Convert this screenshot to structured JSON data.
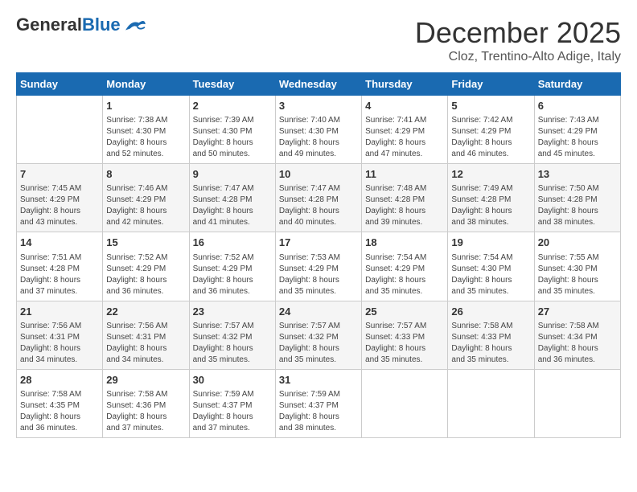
{
  "header": {
    "logo_general": "General",
    "logo_blue": "Blue",
    "month_title": "December 2025",
    "location": "Cloz, Trentino-Alto Adige, Italy"
  },
  "weekdays": [
    "Sunday",
    "Monday",
    "Tuesday",
    "Wednesday",
    "Thursday",
    "Friday",
    "Saturday"
  ],
  "weeks": [
    [
      {
        "day": "",
        "info": ""
      },
      {
        "day": "1",
        "info": "Sunrise: 7:38 AM\nSunset: 4:30 PM\nDaylight: 8 hours\nand 52 minutes."
      },
      {
        "day": "2",
        "info": "Sunrise: 7:39 AM\nSunset: 4:30 PM\nDaylight: 8 hours\nand 50 minutes."
      },
      {
        "day": "3",
        "info": "Sunrise: 7:40 AM\nSunset: 4:30 PM\nDaylight: 8 hours\nand 49 minutes."
      },
      {
        "day": "4",
        "info": "Sunrise: 7:41 AM\nSunset: 4:29 PM\nDaylight: 8 hours\nand 47 minutes."
      },
      {
        "day": "5",
        "info": "Sunrise: 7:42 AM\nSunset: 4:29 PM\nDaylight: 8 hours\nand 46 minutes."
      },
      {
        "day": "6",
        "info": "Sunrise: 7:43 AM\nSunset: 4:29 PM\nDaylight: 8 hours\nand 45 minutes."
      }
    ],
    [
      {
        "day": "7",
        "info": "Sunrise: 7:45 AM\nSunset: 4:29 PM\nDaylight: 8 hours\nand 43 minutes."
      },
      {
        "day": "8",
        "info": "Sunrise: 7:46 AM\nSunset: 4:29 PM\nDaylight: 8 hours\nand 42 minutes."
      },
      {
        "day": "9",
        "info": "Sunrise: 7:47 AM\nSunset: 4:28 PM\nDaylight: 8 hours\nand 41 minutes."
      },
      {
        "day": "10",
        "info": "Sunrise: 7:47 AM\nSunset: 4:28 PM\nDaylight: 8 hours\nand 40 minutes."
      },
      {
        "day": "11",
        "info": "Sunrise: 7:48 AM\nSunset: 4:28 PM\nDaylight: 8 hours\nand 39 minutes."
      },
      {
        "day": "12",
        "info": "Sunrise: 7:49 AM\nSunset: 4:28 PM\nDaylight: 8 hours\nand 38 minutes."
      },
      {
        "day": "13",
        "info": "Sunrise: 7:50 AM\nSunset: 4:28 PM\nDaylight: 8 hours\nand 38 minutes."
      }
    ],
    [
      {
        "day": "14",
        "info": "Sunrise: 7:51 AM\nSunset: 4:28 PM\nDaylight: 8 hours\nand 37 minutes."
      },
      {
        "day": "15",
        "info": "Sunrise: 7:52 AM\nSunset: 4:29 PM\nDaylight: 8 hours\nand 36 minutes."
      },
      {
        "day": "16",
        "info": "Sunrise: 7:52 AM\nSunset: 4:29 PM\nDaylight: 8 hours\nand 36 minutes."
      },
      {
        "day": "17",
        "info": "Sunrise: 7:53 AM\nSunset: 4:29 PM\nDaylight: 8 hours\nand 35 minutes."
      },
      {
        "day": "18",
        "info": "Sunrise: 7:54 AM\nSunset: 4:29 PM\nDaylight: 8 hours\nand 35 minutes."
      },
      {
        "day": "19",
        "info": "Sunrise: 7:54 AM\nSunset: 4:30 PM\nDaylight: 8 hours\nand 35 minutes."
      },
      {
        "day": "20",
        "info": "Sunrise: 7:55 AM\nSunset: 4:30 PM\nDaylight: 8 hours\nand 35 minutes."
      }
    ],
    [
      {
        "day": "21",
        "info": "Sunrise: 7:56 AM\nSunset: 4:31 PM\nDaylight: 8 hours\nand 34 minutes."
      },
      {
        "day": "22",
        "info": "Sunrise: 7:56 AM\nSunset: 4:31 PM\nDaylight: 8 hours\nand 34 minutes."
      },
      {
        "day": "23",
        "info": "Sunrise: 7:57 AM\nSunset: 4:32 PM\nDaylight: 8 hours\nand 35 minutes."
      },
      {
        "day": "24",
        "info": "Sunrise: 7:57 AM\nSunset: 4:32 PM\nDaylight: 8 hours\nand 35 minutes."
      },
      {
        "day": "25",
        "info": "Sunrise: 7:57 AM\nSunset: 4:33 PM\nDaylight: 8 hours\nand 35 minutes."
      },
      {
        "day": "26",
        "info": "Sunrise: 7:58 AM\nSunset: 4:33 PM\nDaylight: 8 hours\nand 35 minutes."
      },
      {
        "day": "27",
        "info": "Sunrise: 7:58 AM\nSunset: 4:34 PM\nDaylight: 8 hours\nand 36 minutes."
      }
    ],
    [
      {
        "day": "28",
        "info": "Sunrise: 7:58 AM\nSunset: 4:35 PM\nDaylight: 8 hours\nand 36 minutes."
      },
      {
        "day": "29",
        "info": "Sunrise: 7:58 AM\nSunset: 4:36 PM\nDaylight: 8 hours\nand 37 minutes."
      },
      {
        "day": "30",
        "info": "Sunrise: 7:59 AM\nSunset: 4:37 PM\nDaylight: 8 hours\nand 37 minutes."
      },
      {
        "day": "31",
        "info": "Sunrise: 7:59 AM\nSunset: 4:37 PM\nDaylight: 8 hours\nand 38 minutes."
      },
      {
        "day": "",
        "info": ""
      },
      {
        "day": "",
        "info": ""
      },
      {
        "day": "",
        "info": ""
      }
    ]
  ]
}
